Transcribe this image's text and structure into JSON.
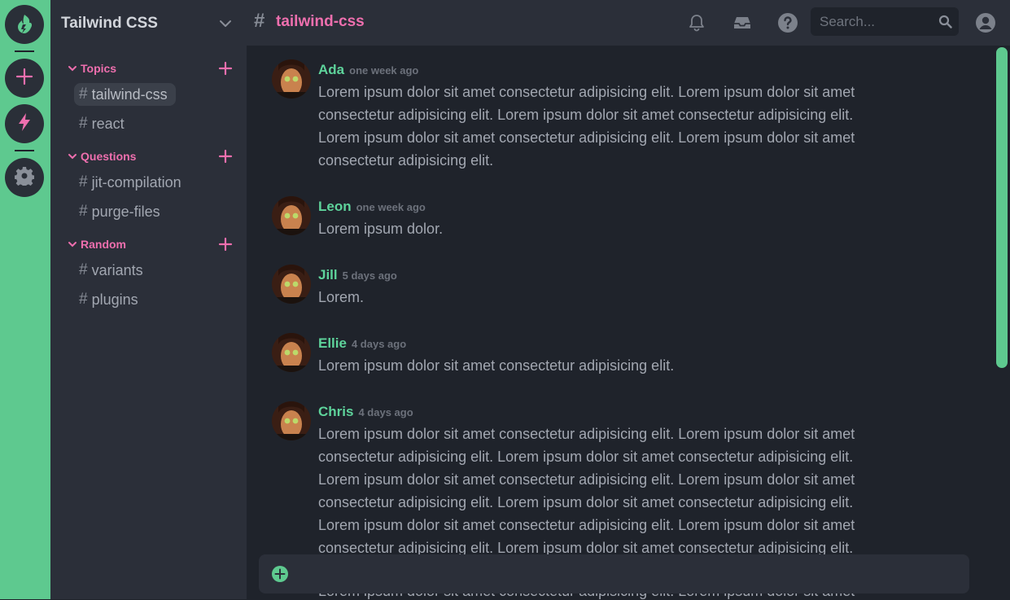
{
  "workspace": {
    "name": "Tailwind CSS"
  },
  "rail": {
    "items": [
      {
        "icon": "logo-icon"
      },
      {
        "icon": "plus-icon"
      },
      {
        "icon": "bolt-icon"
      },
      {
        "icon": "gear-icon"
      }
    ]
  },
  "sidebar": {
    "groups": [
      {
        "label": "Topics",
        "channels": [
          "tailwind-css",
          "react"
        ]
      },
      {
        "label": "Questions",
        "channels": [
          "jit-compilation",
          "purge-files"
        ]
      },
      {
        "label": "Random",
        "channels": [
          "variants",
          "plugins"
        ]
      }
    ],
    "hash": "#"
  },
  "header": {
    "hash": "#",
    "channel": "tailwind-css",
    "search_placeholder": "Search..."
  },
  "messages": [
    {
      "author": "Ada",
      "time": "one week ago",
      "text": "Lorem ipsum dolor sit amet consectetur adipisicing elit. Lorem ipsum dolor sit amet consectetur adipisicing elit. Lorem ipsum dolor sit amet consectetur adipisicing elit. Lorem ipsum dolor sit amet consectetur adipisicing elit. Lorem ipsum dolor sit amet consectetur adipisicing elit."
    },
    {
      "author": "Leon",
      "time": "one week ago",
      "text": "Lorem ipsum dolor."
    },
    {
      "author": "Jill",
      "time": "5 days ago",
      "text": "Lorem."
    },
    {
      "author": "Ellie",
      "time": "4 days ago",
      "text": "Lorem ipsum dolor sit amet consectetur adipisicing elit."
    },
    {
      "author": "Chris",
      "time": "4 days ago",
      "text": "Lorem ipsum dolor sit amet consectetur adipisicing elit. Lorem ipsum dolor sit amet consectetur adipisicing elit. Lorem ipsum dolor sit amet consectetur adipisicing elit. Lorem ipsum dolor sit amet consectetur adipisicing elit. Lorem ipsum dolor sit amet consectetur adipisicing elit. Lorem ipsum dolor sit amet consectetur adipisicing elit. Lorem ipsum dolor sit amet consectetur adipisicing elit. Lorem ipsum dolor sit amet consectetur adipisicing elit. Lorem ipsum dolor sit amet consectetur adipisicing elit."
    }
  ],
  "composer": {
    "placeholder": ""
  },
  "under_composer_text": "Lorem ipsum dolor sit amet consectetur adipisicing elit. Lorem ipsum dolor sit amet",
  "colors": {
    "accent": "#5ec98f",
    "pink": "#ee6fae",
    "author": "#5ed39b"
  }
}
